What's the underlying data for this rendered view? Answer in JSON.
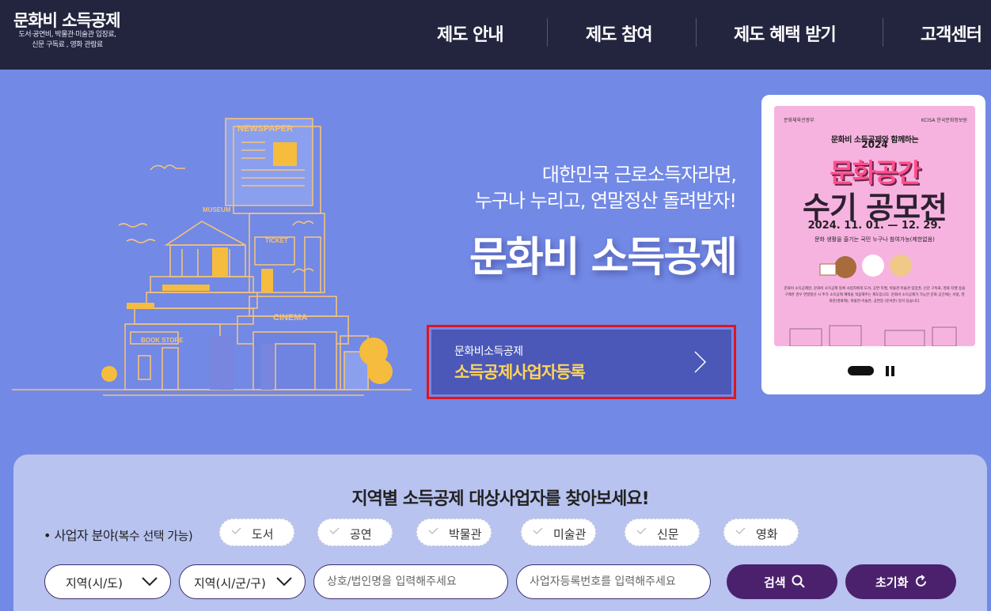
{
  "header": {
    "logo_title": "문화비 소득공제",
    "logo_sub_1": "도서·공연비, 박물관·미술관 입장료,",
    "logo_sub_2": "신문 구독료 , 영화 관람료",
    "nav": [
      "제도 안내",
      "제도 참여",
      "제도 혜택 받기",
      "고객센터"
    ]
  },
  "hero": {
    "subtitle_1": "대한민국 근로소득자라면,",
    "subtitle_2": "누구나 누리고, 연말정산 돌려받자!",
    "title": "문화비 소득공제",
    "illustration_labels": [
      "NEWSPAPER",
      "MUSEUM",
      "TICKET",
      "CINEMA",
      "BOOK STORE"
    ],
    "cta_small": "문화비소득공제",
    "cta_big": "소득공제사업자등록"
  },
  "banner": {
    "org_left": "문화체육관광부",
    "org_right": "KCISA 한국문화정보원",
    "tagline": "문화비 소득공제와 함께하는",
    "year": "2024",
    "title_1": "문화공간",
    "title_2": "수기 공모전",
    "date": "2024. 11. 01. — 12. 29.",
    "note": "문화 생활을 즐기는 국민 누구나 참여가능(제한없음)",
    "desc": "문화비 소득공제란, 문화비 소득공제 등록 사업자에게 도서, 공연 티켓, 박물관·미술관 입장권, 신문 구독료, 영화 티켓 등을 구매한 경우 연말정산 시 추가 소득공제 혜택을 적용해주는 제도입니다. 문화비 소득공제가 가능한 문화 공간에는 서점, 영화관(영화제), 박물관·미술관, 공연장 (문서관) 등이 있습니다."
  },
  "search": {
    "title": "지역별 소득공제 대상사업자를 찾아보세요!",
    "field_label": "사업자 분야",
    "field_label_note": "(복수 선택 가능)",
    "categories": [
      "도서",
      "공연",
      "박물관",
      "미술관",
      "신문",
      "영화"
    ],
    "region_select_1": "지역(시/도)",
    "region_select_2": "지역(시/군/구)",
    "name_placeholder": "상호/법인명을 입력해주세요",
    "regno_placeholder": "사업자등록번호를 입력해주세요",
    "search_label": "검색",
    "reset_label": "초기화"
  },
  "colors": {
    "header_bg": "#23253f",
    "hero_bg": "#7289e5",
    "cta_bg": "#4b58b8",
    "cta_highlight": "#ffd45a",
    "cta_outline": "#e0151e",
    "button_bg": "#4b216d",
    "panel_bg": "#b8c3f0"
  }
}
